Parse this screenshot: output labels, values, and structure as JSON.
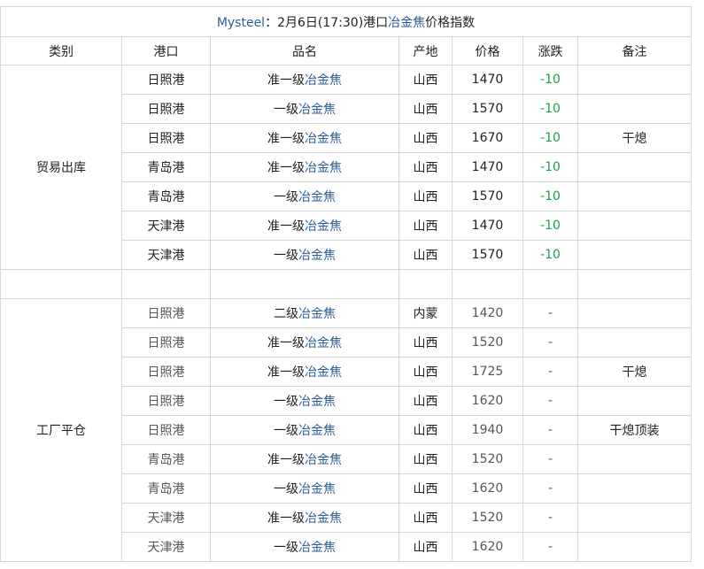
{
  "title": {
    "brand": "Mysteel",
    "colon": "：",
    "date_port": "2月6日(17:30)港口",
    "product_link": "冶金焦",
    "suffix": "价格指数"
  },
  "headers": [
    "类别",
    "港口",
    "品名",
    "产地",
    "价格",
    "涨跌",
    "备注"
  ],
  "groups": [
    {
      "category": "贸易出库",
      "note": "干熄",
      "rows": [
        {
          "port": "日照港",
          "grade": "准一级",
          "product": "冶金焦",
          "origin": "山西",
          "price": "1470",
          "change": "-10"
        },
        {
          "port": "日照港",
          "grade": "一级",
          "product": "冶金焦",
          "origin": "山西",
          "price": "1570",
          "change": "-10"
        },
        {
          "port": "日照港",
          "grade": "准一级",
          "product": "冶金焦",
          "origin": "山西",
          "price": "1670",
          "change": "-10"
        },
        {
          "port": "青岛港",
          "grade": "准一级",
          "product": "冶金焦",
          "origin": "山西",
          "price": "1470",
          "change": "-10"
        },
        {
          "port": "青岛港",
          "grade": "一级",
          "product": "冶金焦",
          "origin": "山西",
          "price": "1570",
          "change": "-10"
        },
        {
          "port": "天津港",
          "grade": "准一级",
          "product": "冶金焦",
          "origin": "山西",
          "price": "1470",
          "change": "-10"
        },
        {
          "port": "天津港",
          "grade": "一级",
          "product": "冶金焦",
          "origin": "山西",
          "price": "1570",
          "change": "-10"
        }
      ]
    },
    {
      "category": "工厂平仓",
      "notes": [
        "干熄",
        "干熄顶装"
      ],
      "rows": [
        {
          "port": "日照港",
          "grade": "二级",
          "product": "冶金焦",
          "origin": "内蒙",
          "price": "1420",
          "change": "-"
        },
        {
          "port": "日照港",
          "grade": "准一级",
          "product": "冶金焦",
          "origin": "山西",
          "price": "1520",
          "change": "-"
        },
        {
          "port": "日照港",
          "grade": "准一级",
          "product": "冶金焦",
          "origin": "山西",
          "price": "1725",
          "change": "-"
        },
        {
          "port": "日照港",
          "grade": "一级",
          "product": "冶金焦",
          "origin": "山西",
          "price": "1620",
          "change": "-"
        },
        {
          "port": "日照港",
          "grade": "一级",
          "product": "冶金焦",
          "origin": "山西",
          "price": "1940",
          "change": "-"
        },
        {
          "port": "青岛港",
          "grade": "准一级",
          "product": "冶金焦",
          "origin": "山西",
          "price": "1520",
          "change": "-"
        },
        {
          "port": "青岛港",
          "grade": "一级",
          "product": "冶金焦",
          "origin": "山西",
          "price": "1620",
          "change": "-"
        },
        {
          "port": "天津港",
          "grade": "准一级",
          "product": "冶金焦",
          "origin": "山西",
          "price": "1520",
          "change": "-"
        },
        {
          "port": "天津港",
          "grade": "一级",
          "product": "冶金焦",
          "origin": "山西",
          "price": "1620",
          "change": "-"
        }
      ]
    }
  ],
  "colors": {
    "link": "#2b5d9a",
    "down": "#1aa24a",
    "border": "#d6d6d6"
  }
}
